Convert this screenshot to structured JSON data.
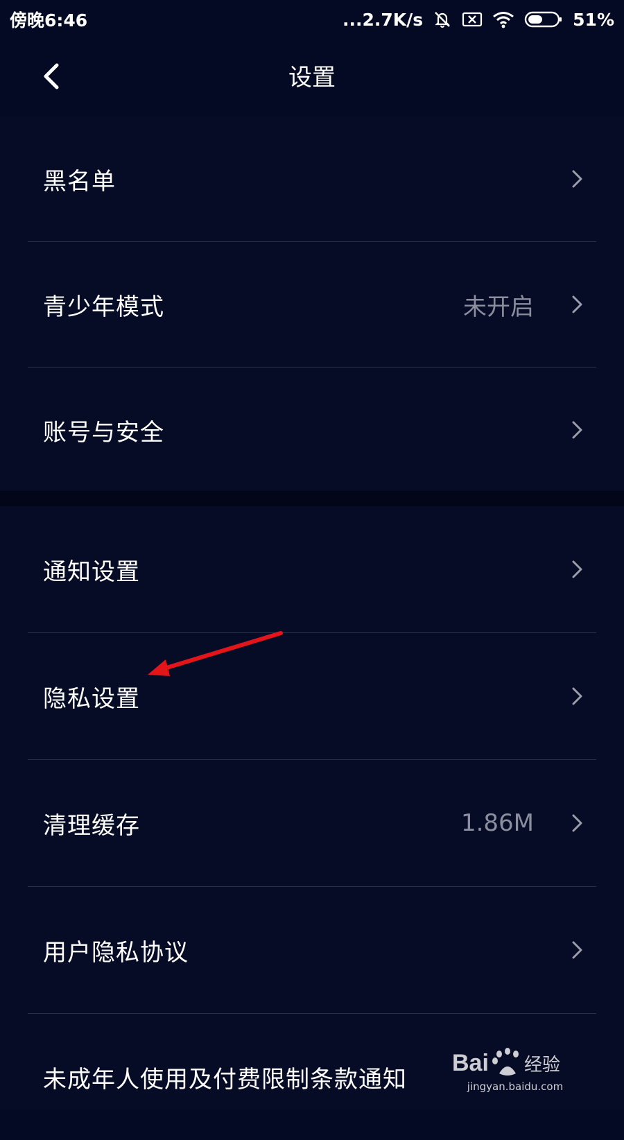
{
  "status_bar": {
    "time": "傍晚6:46",
    "network_speed": "...2.7K/s",
    "battery_percent": "51%",
    "battery_level": 0.51,
    "icons": [
      "mute-bell-icon",
      "sim-x-icon",
      "wifi-icon",
      "battery-icon"
    ]
  },
  "header": {
    "title": "设置",
    "back_icon": "back-chevron-icon"
  },
  "groups": [
    {
      "items": [
        {
          "label": "黑名单",
          "value": ""
        },
        {
          "label": "青少年模式",
          "value": "未开启"
        },
        {
          "label": "账号与安全",
          "value": ""
        }
      ]
    },
    {
      "items": [
        {
          "label": "通知设置",
          "value": ""
        },
        {
          "label": "隐私设置",
          "value": ""
        },
        {
          "label": "清理缓存",
          "value": "1.86M"
        },
        {
          "label": "用户隐私协议",
          "value": ""
        },
        {
          "label": "未成年人使用及付费限制条款通知",
          "value": ""
        }
      ]
    }
  ],
  "annotation": {
    "icon": "red-arrow-icon",
    "color": "#e3151a"
  },
  "watermark": {
    "logo_text": "Bai 经验",
    "url": "jingyan.baidu.com"
  },
  "colors": {
    "background": "#050a24",
    "text": "#ffffff",
    "secondary_text": "#8a8e9e",
    "divider": "#2a2f4a",
    "chevron": "#9a9eac"
  }
}
